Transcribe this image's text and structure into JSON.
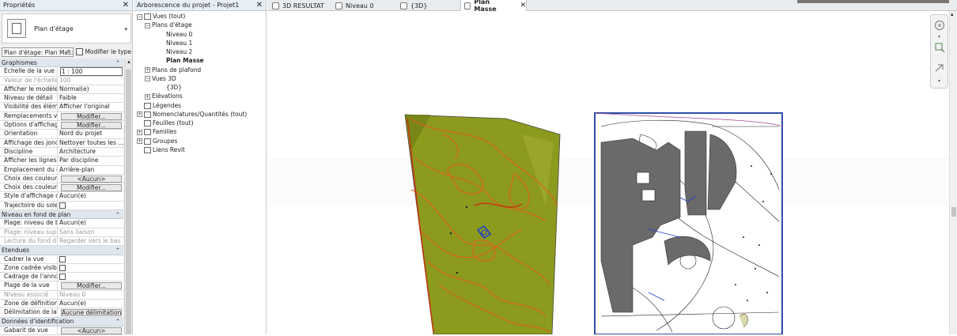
{
  "properties": {
    "title": "Propriétés",
    "type_name": "Plan d'étage",
    "filter_value": "Plan d'étage: Plan Mas:",
    "edit_type_label": "Modifier le type",
    "categories": [
      {
        "label": "Graphismes",
        "rows": [
          {
            "name": "Echelle de la vue",
            "value": "1 : 100",
            "kind": "input"
          },
          {
            "name": "Valeur de l'échelle ...",
            "value": "100",
            "kind": "grey"
          },
          {
            "name": "Afficher le modèle",
            "value": "Normal(e)"
          },
          {
            "name": "Niveau de détail",
            "value": "Faible"
          },
          {
            "name": "Visibilité des élém...",
            "value": "Afficher l'original"
          },
          {
            "name": "Remplacements vi...",
            "value": "Modifier...",
            "kind": "button"
          },
          {
            "name": "Options d'affichag...",
            "value": "Modifier...",
            "kind": "button"
          },
          {
            "name": "Orientation",
            "value": "Nord du projet"
          },
          {
            "name": "Affichage des jonc...",
            "value": "Nettoyer toutes les ..."
          },
          {
            "name": "Discipline",
            "value": "Architecture"
          },
          {
            "name": "Afficher les lignes ...",
            "value": "Par discipline"
          },
          {
            "name": "Emplacement du c...",
            "value": "Arrière-plan"
          },
          {
            "name": "Choix des couleurs",
            "value": "<Aucun>",
            "kind": "button"
          },
          {
            "name": "Choix des couleur...",
            "value": "Modifier...",
            "kind": "button"
          },
          {
            "name": "Style d'affichage d...",
            "value": "Aucun(e)"
          },
          {
            "name": "Trajectoire du soleil",
            "value": "",
            "kind": "check"
          }
        ]
      },
      {
        "label": "Niveau en fond de plan",
        "rows": [
          {
            "name": "Plage: niveau de b...",
            "value": "Aucun(e)"
          },
          {
            "name": "Plage: niveau supé...",
            "value": "Sans liaison",
            "kind": "grey"
          },
          {
            "name": "Lecture du fond d...",
            "value": "Regarder vers le bas",
            "kind": "grey"
          }
        ]
      },
      {
        "label": "Etendues",
        "rows": [
          {
            "name": "Cadrer la vue",
            "value": "",
            "kind": "check"
          },
          {
            "name": "Zone cadrée visible",
            "value": "",
            "kind": "check"
          },
          {
            "name": "Cadrage de l'anno...",
            "value": "",
            "kind": "check"
          },
          {
            "name": "Plage de la vue",
            "value": "Modifier...",
            "kind": "button"
          },
          {
            "name": "Niveau associé",
            "value": "Niveau 0",
            "kind": "grey"
          },
          {
            "name": "Zone de définition",
            "value": "Aucun(e)"
          },
          {
            "name": "Délimitation de la ...",
            "value": "Aucune délimitation",
            "kind": "button"
          }
        ]
      },
      {
        "label": "Données d'identification",
        "rows": [
          {
            "name": "Gabarit de vue",
            "value": "<Aucun>",
            "kind": "button"
          }
        ]
      }
    ]
  },
  "browser": {
    "title": "Arborescence du projet - Projet1",
    "items": [
      {
        "label": "Vues (tout)",
        "depth": 0,
        "exp": "−",
        "icon": true
      },
      {
        "label": "Plans d'étage",
        "depth": 1,
        "exp": "−"
      },
      {
        "label": "Niveau 0",
        "depth": 3
      },
      {
        "label": "Niveau 1",
        "depth": 3
      },
      {
        "label": "Niveau 2",
        "depth": 3
      },
      {
        "label": "Plan Masse",
        "depth": 3,
        "bold": true
      },
      {
        "label": "Plans de plafond",
        "depth": 1,
        "exp": "+"
      },
      {
        "label": "Vues 3D",
        "depth": 1,
        "exp": "−"
      },
      {
        "label": "{3D}",
        "depth": 3
      },
      {
        "label": "Elévations",
        "depth": 1,
        "exp": "+"
      },
      {
        "label": "Légendes",
        "depth": 0,
        "icon": true
      },
      {
        "label": "Nomenclatures/Quantités (tout)",
        "depth": 0,
        "exp": "+",
        "icon": true
      },
      {
        "label": "Feuilles (tout)",
        "depth": 0,
        "icon": true
      },
      {
        "label": "Familles",
        "depth": 0,
        "exp": "+",
        "icon": true
      },
      {
        "label": "Groupes",
        "depth": 0,
        "exp": "+",
        "icon": true
      },
      {
        "label": "Liens Revit",
        "depth": 0,
        "icon": true
      }
    ]
  },
  "tabs": [
    {
      "label": "3D RESULTAT"
    },
    {
      "label": "Niveau 0"
    },
    {
      "label": "{3D}"
    },
    {
      "label": "Plan Masse",
      "active": true
    }
  ],
  "colors": {
    "terrain": "#8c9a1e",
    "contour": "#e0601c",
    "plan_frame": "#2f4fa8",
    "building": "#6a6a6a"
  }
}
